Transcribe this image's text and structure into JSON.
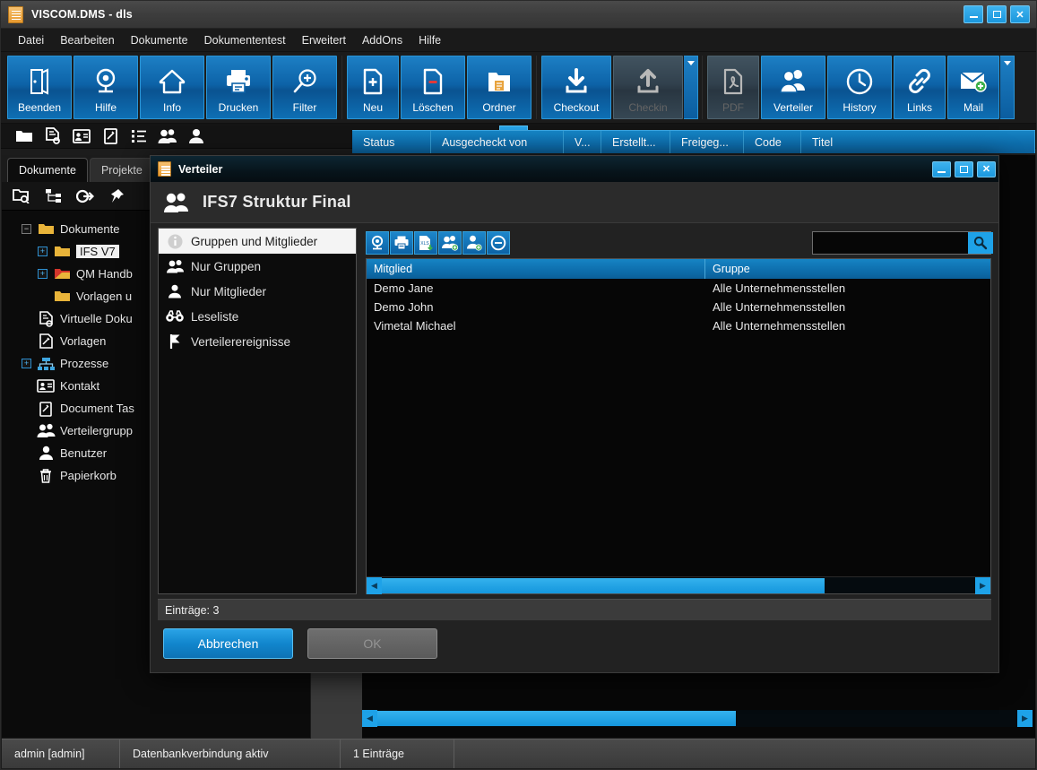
{
  "window": {
    "title": "VISCOM.DMS - dls",
    "controls": {
      "minimize": "_",
      "maximize": "□",
      "close": "✕"
    }
  },
  "menubar": {
    "items": [
      {
        "label": "Datei"
      },
      {
        "label": "Bearbeiten"
      },
      {
        "label": "Dokumente"
      },
      {
        "label": "Dokumententest"
      },
      {
        "label": "Erweitert"
      },
      {
        "label": "AddOns"
      },
      {
        "label": "Hilfe"
      }
    ]
  },
  "ribbon": {
    "groups": [
      {
        "buttons": [
          {
            "label": "Beenden",
            "icon": "exit-door-icon",
            "disabled": false
          },
          {
            "label": "Hilfe",
            "icon": "lifebuoy-icon",
            "disabled": false
          },
          {
            "label": "Info",
            "icon": "home-icon",
            "disabled": false
          },
          {
            "label": "Drucken",
            "icon": "printer-icon",
            "disabled": false
          },
          {
            "label": "Filter",
            "icon": "filter-search-icon",
            "disabled": false
          }
        ]
      },
      {
        "buttons": [
          {
            "label": "Neu",
            "icon": "new-document-icon",
            "disabled": false
          },
          {
            "label": "Löschen",
            "icon": "delete-document-icon",
            "disabled": false
          },
          {
            "label": "Ordner",
            "icon": "folder-icon",
            "disabled": false
          }
        ]
      },
      {
        "buttons": [
          {
            "label": "Checkout",
            "icon": "checkout-download-icon",
            "disabled": false
          },
          {
            "label": "Checkin",
            "icon": "checkin-upload-icon",
            "disabled": true
          }
        ],
        "has_dropdown": true
      },
      {
        "buttons": [
          {
            "label": "PDF",
            "icon": "pdf-icon",
            "disabled": true
          },
          {
            "label": "Verteiler",
            "icon": "distribution-group-icon",
            "disabled": false
          },
          {
            "label": "History",
            "icon": "clock-history-icon",
            "disabled": false
          },
          {
            "label": "Links",
            "icon": "chain-links-icon",
            "disabled": false
          },
          {
            "label": "Mail",
            "icon": "mail-add-icon",
            "disabled": false
          }
        ],
        "has_dropdown": true
      }
    ]
  },
  "iconstrip": {
    "icons": [
      "folder-icon",
      "document-search-icon",
      "contact-card-icon",
      "task-edit-icon",
      "list-icon",
      "group-icon",
      "user-icon"
    ],
    "view_toggle": "hamburger-view-icon"
  },
  "main_grid": {
    "columns": [
      "Status",
      "Ausgecheckt von",
      "V...",
      "Erstellt...",
      "Freigeg...",
      "Code",
      "Titel"
    ]
  },
  "left_panel": {
    "tabs": [
      {
        "label": "Dokumente",
        "active": true
      },
      {
        "label": "Projekte",
        "active": false
      }
    ],
    "toolbar_icons": [
      "folder-search-icon",
      "tree-structure-icon",
      "goto-icon",
      "pin-icon"
    ],
    "tree": [
      {
        "label": "Dokumente",
        "icon": "folder-open-icon",
        "level": 0,
        "expander": "minus",
        "selected": false
      },
      {
        "label": "IFS V7",
        "icon": "folder-icon",
        "level": 1,
        "expander": "plus",
        "selected": true
      },
      {
        "label": "QM Handb",
        "icon": "folder-red-icon",
        "level": 1,
        "expander": "plus",
        "selected": false
      },
      {
        "label": "Vorlagen u",
        "icon": "folder-icon",
        "level": 1,
        "expander": "none",
        "selected": false
      },
      {
        "label": "Virtuelle Doku",
        "icon": "virtual-document-icon",
        "level": 0,
        "expander": "none",
        "selected": false
      },
      {
        "label": "Vorlagen",
        "icon": "template-icon",
        "level": 0,
        "expander": "none",
        "selected": false
      },
      {
        "label": "Prozesse",
        "icon": "process-icon",
        "level": 0,
        "expander": "plus",
        "selected": false
      },
      {
        "label": "Kontakt",
        "icon": "contact-card-icon",
        "level": 0,
        "expander": "none",
        "selected": false
      },
      {
        "label": "Document Tas",
        "icon": "task-edit-icon",
        "level": 0,
        "expander": "none",
        "selected": false
      },
      {
        "label": "Verteilergrupp",
        "icon": "group-icon",
        "level": 0,
        "expander": "none",
        "selected": false
      },
      {
        "label": "Benutzer",
        "icon": "user-icon",
        "level": 0,
        "expander": "none",
        "selected": false
      },
      {
        "label": "Papierkorb",
        "icon": "trash-icon",
        "level": 0,
        "expander": "none",
        "selected": false
      }
    ]
  },
  "dialog": {
    "title": "Verteiler",
    "header": "IFS7 Struktur Final",
    "header_icon": "group-icon",
    "controls": {
      "minimize": "_",
      "maximize": "□",
      "close": "✕"
    },
    "side_list": [
      {
        "label": "Gruppen und Mitglieder",
        "icon": "info-icon",
        "active": true
      },
      {
        "label": "Nur Gruppen",
        "icon": "group-icon",
        "active": false
      },
      {
        "label": "Nur Mitglieder",
        "icon": "user-icon",
        "active": false
      },
      {
        "label": "Leseliste",
        "icon": "binoculars-icon",
        "active": false
      },
      {
        "label": "Verteilerereignisse",
        "icon": "flag-icon",
        "active": false
      }
    ],
    "toolbar_icons": [
      "lifebuoy-help-icon",
      "printer-icon",
      "xls-export-icon",
      "add-group-icon",
      "add-member-icon",
      "remove-circle-icon"
    ],
    "search": {
      "value": "",
      "placeholder": "",
      "button_icon": "search-icon"
    },
    "grid": {
      "columns": [
        "Mitglied",
        "Gruppe"
      ],
      "rows": [
        {
          "Mitglied": "Demo Jane",
          "Gruppe": "Alle Unternehmensstellen"
        },
        {
          "Mitglied": "Demo John",
          "Gruppe": "Alle Unternehmensstellen"
        },
        {
          "Mitglied": "Vimetal Michael",
          "Gruppe": "Alle Unternehmensstellen"
        }
      ]
    },
    "status": "Einträge: 3",
    "buttons": {
      "cancel": "Abbrechen",
      "ok": "OK"
    }
  },
  "statusbar": {
    "user": "admin [admin]",
    "connection": "Datenbankverbindung aktiv",
    "entries": "1 Einträge"
  },
  "colors": {
    "accent": "#1ea2e8",
    "ribbon_blue": "#0d63a8",
    "header_blue": "#0e6fae",
    "window_bg": "#1c1c1c",
    "dialog_bg": "#222222"
  }
}
